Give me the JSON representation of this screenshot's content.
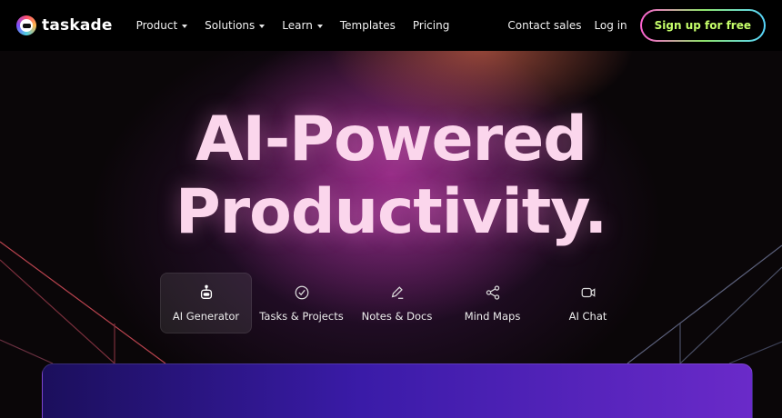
{
  "nav": {
    "brand": "taskade",
    "menu": [
      {
        "label": "Product",
        "has_caret": true
      },
      {
        "label": "Solutions",
        "has_caret": true
      },
      {
        "label": "Learn",
        "has_caret": true
      },
      {
        "label": "Templates",
        "has_caret": false
      },
      {
        "label": "Pricing",
        "has_caret": false
      }
    ],
    "contact_sales": "Contact sales",
    "login": "Log in",
    "signup": "Sign up for free"
  },
  "hero": {
    "headline_line1": "AI-Powered",
    "headline_line2": "Productivity."
  },
  "tabs": [
    {
      "label": "AI Generator",
      "icon": "robot-icon",
      "active": true
    },
    {
      "label": "Tasks & Projects",
      "icon": "check-circle-icon",
      "active": false
    },
    {
      "label": "Notes & Docs",
      "icon": "pencil-icon",
      "active": false
    },
    {
      "label": "Mind Maps",
      "icon": "share-nodes-icon",
      "active": false
    },
    {
      "label": "AI Chat",
      "icon": "video-chat-icon",
      "active": false
    }
  ],
  "colors": {
    "signup_text": "#c6ff6a",
    "headline": "#fbd6ec",
    "panel_start": "#1b0f5c",
    "panel_end": "#6a2ac9"
  }
}
